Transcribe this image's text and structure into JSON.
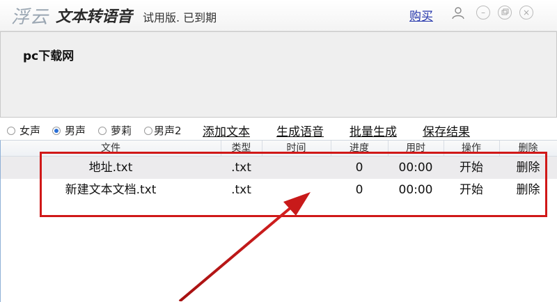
{
  "app": {
    "brand": "浮云",
    "product": "文本转语音",
    "trial_status": "试用版. 已到期",
    "buy_label": "购买"
  },
  "window_controls": [
    "user-icon",
    "minimize-icon",
    "restore-icon",
    "close-icon"
  ],
  "text_input": {
    "value": "pc下载网"
  },
  "voices": [
    {
      "label": "女声",
      "selected": false
    },
    {
      "label": "男声",
      "selected": true
    },
    {
      "label": "萝莉",
      "selected": false
    },
    {
      "label": "男声2",
      "selected": false
    }
  ],
  "actions": [
    "添加文本",
    "生成语音",
    "批量生成",
    "保存结果"
  ],
  "table": {
    "headers": [
      "文件",
      "类型",
      "时间",
      "进度",
      "用时",
      "操作",
      "删除"
    ],
    "rows": [
      {
        "file": "地址.txt",
        "type": ".txt",
        "time": "",
        "progress": "0",
        "elapsed": "00:00",
        "op": "开始",
        "del": "删除"
      },
      {
        "file": "新建文本文档.txt",
        "type": ".txt",
        "time": "",
        "progress": "0",
        "elapsed": "00:00",
        "op": "开始",
        "del": "删除"
      }
    ]
  },
  "annotation": {
    "color": "#d01818"
  }
}
